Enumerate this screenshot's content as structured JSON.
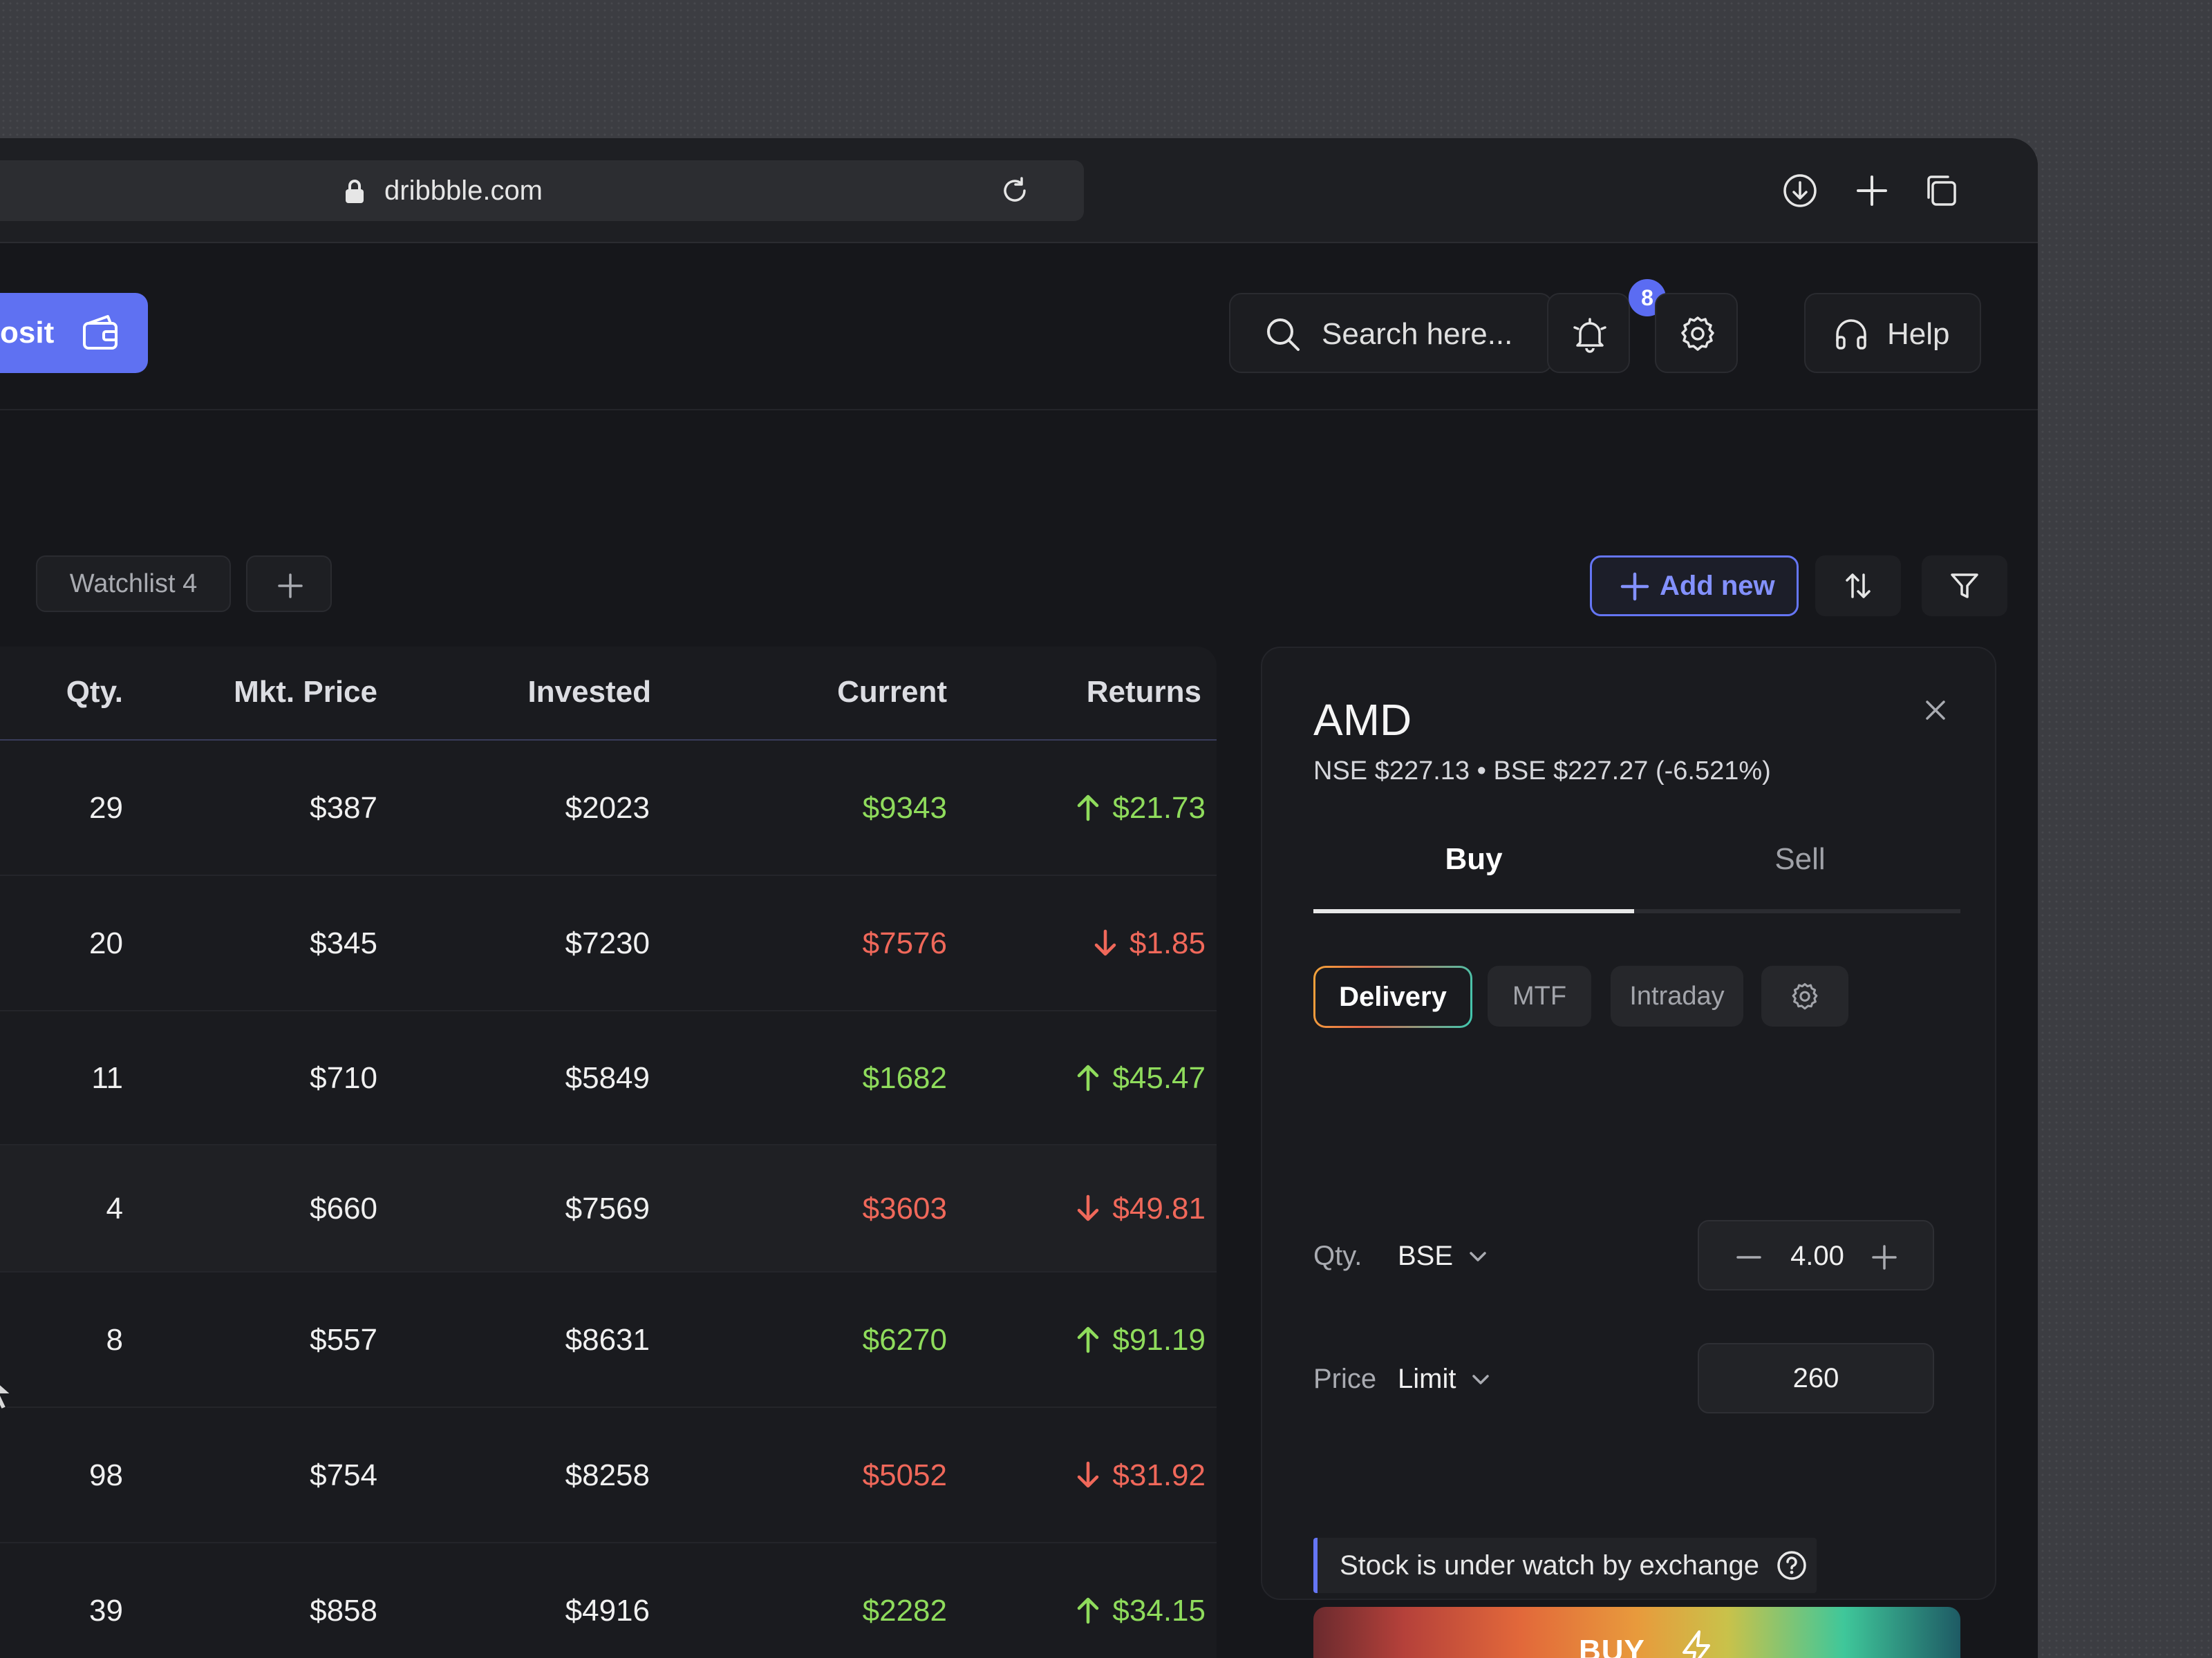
{
  "browser": {
    "url": "dribbble.com"
  },
  "header": {
    "deposit_label": "osit",
    "search_placeholder": "Search here...",
    "notification_count": "8",
    "help_label": "Help"
  },
  "watchlist": {
    "tabs": [
      {
        "label": "Watchlist 4"
      }
    ],
    "add_new_label": "Add new"
  },
  "table": {
    "columns": [
      "Qty.",
      "Mkt. Price",
      "Invested",
      "Current",
      "Returns"
    ],
    "rows": [
      {
        "qty": "29",
        "mkt_price": "$387",
        "invested": "$2023",
        "current": "$9343",
        "returns": "$21.73",
        "trend": "up"
      },
      {
        "qty": "20",
        "mkt_price": "$345",
        "invested": "$7230",
        "current": "$7576",
        "returns": "$1.85",
        "trend": "down"
      },
      {
        "qty": "11",
        "mkt_price": "$710",
        "invested": "$5849",
        "current": "$1682",
        "returns": "$45.47",
        "trend": "up"
      },
      {
        "qty": "4",
        "mkt_price": "$660",
        "invested": "$7569",
        "current": "$3603",
        "returns": "$49.81",
        "trend": "down"
      },
      {
        "qty": "8",
        "mkt_price": "$557",
        "invested": "$8631",
        "current": "$6270",
        "returns": "$91.19",
        "trend": "up"
      },
      {
        "qty": "98",
        "mkt_price": "$754",
        "invested": "$8258",
        "current": "$5052",
        "returns": "$31.92",
        "trend": "down"
      },
      {
        "qty": "39",
        "mkt_price": "$858",
        "invested": "$4916",
        "current": "$2282",
        "returns": "$34.15",
        "trend": "up"
      }
    ]
  },
  "order_panel": {
    "symbol": "AMD",
    "subtitle": "NSE $227.13  •  BSE $227.27 (-6.521%)",
    "tabs": {
      "buy": "Buy",
      "sell": "Sell"
    },
    "order_types": {
      "delivery": "Delivery",
      "mtf": "MTF",
      "intraday": "Intraday"
    },
    "qty_label": "Qty.",
    "qty_exchange": "BSE",
    "qty_value": "4.00",
    "price_label": "Price",
    "price_type": "Limit",
    "price_value": "260",
    "notice": "Stock is under watch by exchange",
    "buy_label": "BUY"
  },
  "colors": {
    "accent": "#5f71f2",
    "positive": "#8fdc5c",
    "negative": "#f0685a"
  }
}
